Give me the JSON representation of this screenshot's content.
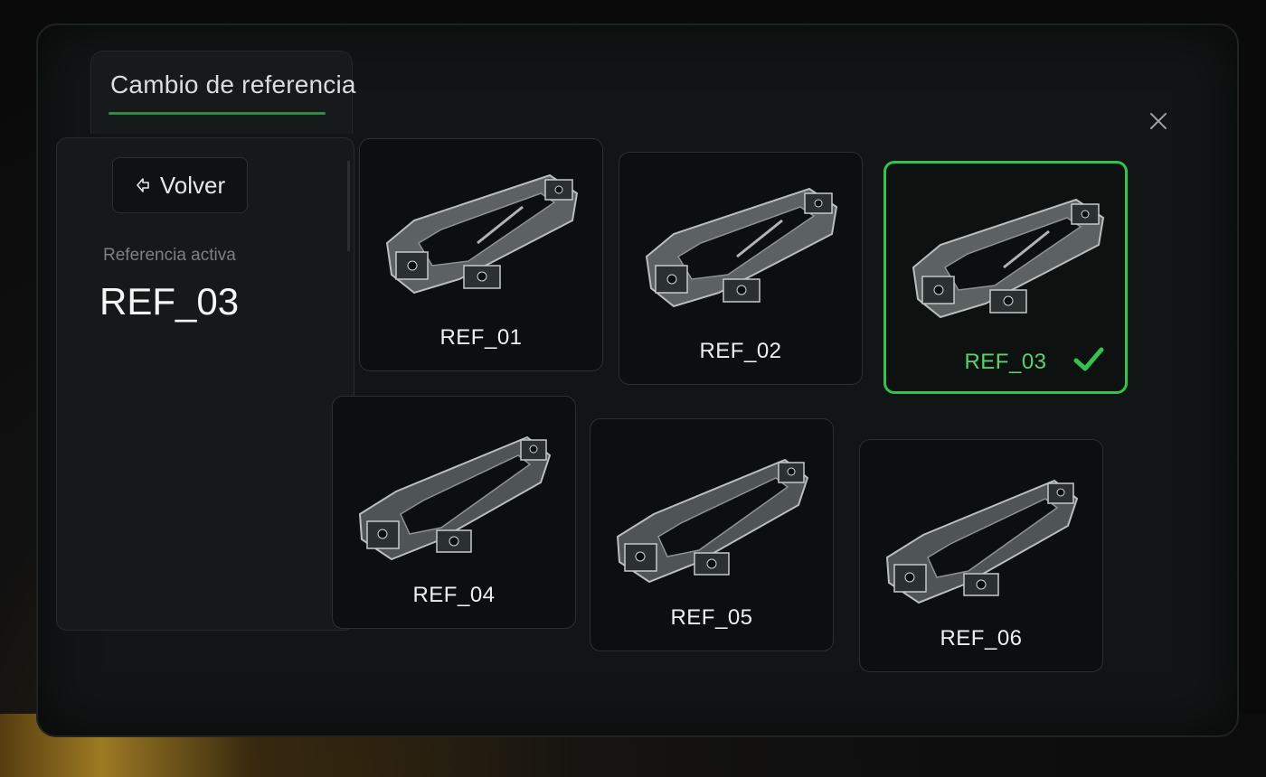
{
  "panel": {
    "title": "Cambio de referencia",
    "back_label": "Volver",
    "active_label": "Referencia activa",
    "active_value": "REF_03"
  },
  "icons": {
    "back": "back-arrow-icon",
    "close": "close-icon",
    "check": "checkmark-icon"
  },
  "colors": {
    "accent": "#34c24f",
    "card_border": "#2a302f",
    "background": "#121515"
  },
  "references": [
    {
      "label": "REF_01",
      "selected": false
    },
    {
      "label": "REF_02",
      "selected": false
    },
    {
      "label": "REF_03",
      "selected": true
    },
    {
      "label": "REF_04",
      "selected": false
    },
    {
      "label": "REF_05",
      "selected": false
    },
    {
      "label": "REF_06",
      "selected": false
    }
  ]
}
